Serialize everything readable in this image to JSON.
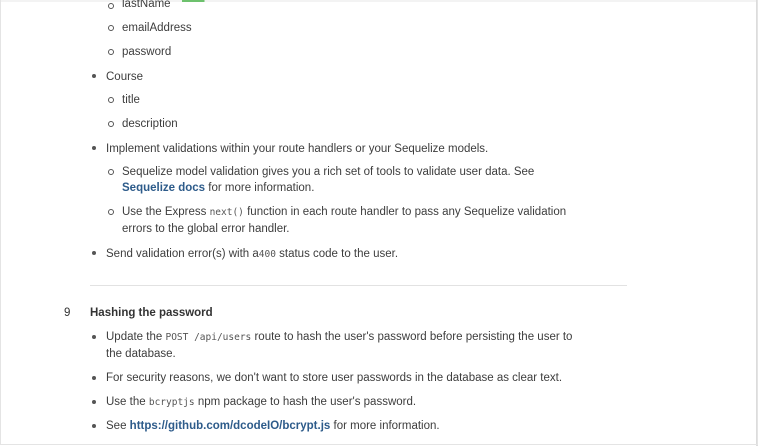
{
  "user_fields": [
    "lastName",
    "emailAddress",
    "password"
  ],
  "course": {
    "label": "Course",
    "fields": [
      "title",
      "description"
    ]
  },
  "validations": {
    "intro": "Implement validations within your route handlers or your Sequelize models.",
    "sequelize_pre": "Sequelize model validation gives you a rich set of tools to validate user data. See",
    "sequelize_link": "Sequelize docs",
    "sequelize_post": "for more information.",
    "express_pre": "Use the Express",
    "express_code": "next()",
    "express_post": "function in each route handler to pass any Sequelize validation",
    "express_line2": "errors to the global error handler.",
    "send_pre": "Send validation error(s) with a",
    "send_code": "400",
    "send_post": "status code to the user."
  },
  "step": {
    "number": "9",
    "title": "Hashing the password",
    "update_pre": "Update the",
    "update_code": "POST /api/users",
    "update_post": "route to hash the user's password before persisting the user to",
    "update_line2": "the database.",
    "security": "For security reasons, we don't want to store user passwords in the database as clear text.",
    "use_pre": "Use the",
    "use_code": "bcryptjs",
    "use_post": "npm package to hash the user's password.",
    "see_pre": "See",
    "see_link": "https://github.com/dcodeIO/bcrypt.js",
    "see_post": "for more information."
  }
}
